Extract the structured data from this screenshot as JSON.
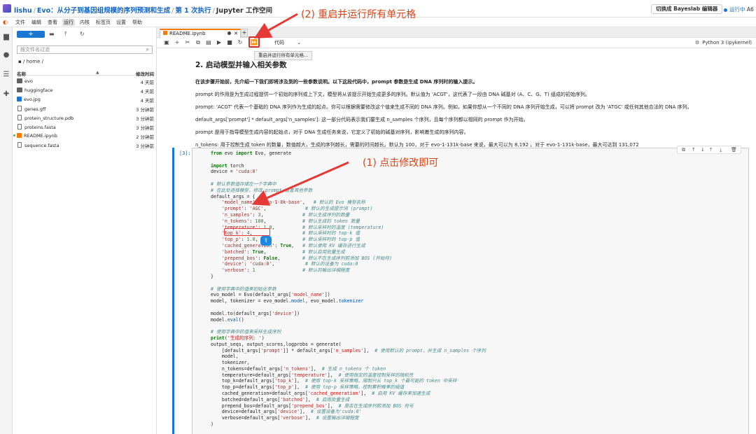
{
  "header": {
    "user": "lishu",
    "project": "Evo：从分子到基因组规模的序列预测和生成",
    "execution": "第 1 次执行",
    "workspace": "Jupyter 工作空间",
    "switch_button": "切换成 Bayeslab 编辑器",
    "status": "运行中",
    "status_extra": "A6"
  },
  "menu": [
    "文件",
    "编辑",
    "查看",
    "运行",
    "内核",
    "标签页",
    "设置",
    "帮助"
  ],
  "sidebar": {
    "filter_placeholder": "按文件名过滤",
    "path": "/ home /",
    "col_name": "名称",
    "col_modified": "修改时间",
    "files": [
      {
        "name": "evo",
        "type": "folder",
        "time": "4 天前"
      },
      {
        "name": "huggingface",
        "type": "folder",
        "time": "4 天前"
      },
      {
        "name": "evo.jpg",
        "type": "image",
        "time": "4 天前"
      },
      {
        "name": "genes.gff",
        "type": "file",
        "time": "3 分钟前"
      },
      {
        "name": "protein_structure.pdb",
        "type": "file",
        "time": "3 分钟前"
      },
      {
        "name": "proteins.fasta",
        "type": "file",
        "time": "3 分钟前"
      },
      {
        "name": "README.ipynb",
        "type": "notebook",
        "time": "2 分钟前"
      },
      {
        "name": "sequence.fasta",
        "type": "file",
        "time": "3 分钟前"
      }
    ]
  },
  "tab": {
    "name": "README.ipynb"
  },
  "toolbar": {
    "cell_type": "代码",
    "kernel": "Python 3 (ipykernel)",
    "tooltip": "重启并运行所有单元格..."
  },
  "doc": {
    "heading": "2. 启动模型并输入相关参数",
    "p1": "在该步骤开始前，先介绍一下我们即将涉及到的一些参数说明。以下这段代码中，prompt 参数是生成 DNA 序列时的输入提示。",
    "p2": "prompt 的作用是为生成过程提供一个初始的序列或上下文，模型将从该提示开始生成更多的序列。默认值为 'ACGT'，这代表了一段由 DNA 碱基对 (A、C、G、T) 组成的初始序列。",
    "p3": "prompt: 'ACGT' 代表一个基础的 DNA 序列作为生成的起点。你可以根据需要修改这个值来生成不同的 DNA 序列。例如，如果你想从一个不同的 DNA 序列开始生成，可以将 prompt 改为 'ATGC' 或任何其他合法的 DNA 序列。",
    "p4": "default_args['prompt'] * default_args['n_samples']: 这一部分代码表示我们要生成 n_samples 个序列，且每个序列都以相同的 prompt 作为开始。",
    "p5": "prompt 是用于指导模型生成内容的起始点，对于 DNA 生成任务来说，它定义了初始的碱基对序列，影响着生成的序列内容。",
    "p6": "n_tokens: 用于控制生成 token 的数量，数值越大，生成的序列越长，需要的时间越长。默认为 100，对于 evo-1-131k-base 来说，最大可以为 8,192 。对于 evo-1-131k-base，最大可达到 131,072"
  },
  "cell": {
    "prompt": "[3]:"
  },
  "annotations": {
    "top": "(2) 重启并运行所有单元格",
    "middle": "(1) 点击修改即可"
  }
}
